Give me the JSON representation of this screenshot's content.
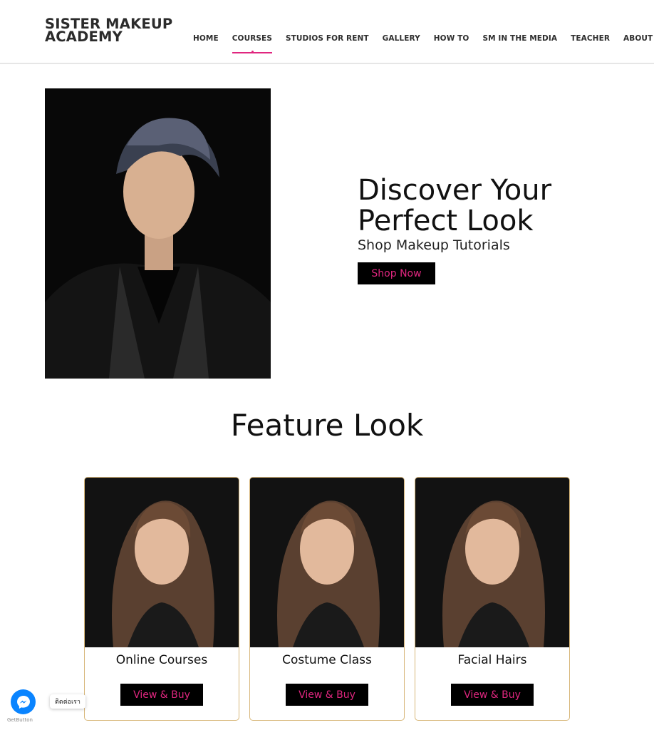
{
  "header": {
    "logo_line1": "SISTER MAKEUP",
    "logo_line2": "ACADEMY",
    "nav": [
      {
        "label": "HOME",
        "active": false
      },
      {
        "label": "COURSES",
        "active": true
      },
      {
        "label": "STUDIOS FOR RENT",
        "active": false
      },
      {
        "label": "GALLERY",
        "active": false
      },
      {
        "label": "HOW TO",
        "active": false
      },
      {
        "label": "SM IN THE MEDIA",
        "active": false
      },
      {
        "label": "TEACHER",
        "active": false
      },
      {
        "label": "ABOUT US",
        "active": false
      }
    ]
  },
  "hero": {
    "title_line1": "Discover Your",
    "title_line2": "Perfect Look",
    "subtitle": "Shop Makeup Tutorials",
    "button_label": "Shop Now"
  },
  "feature": {
    "title": "Feature Look",
    "cards": [
      {
        "label": "Online Courses",
        "button_label": "View & Buy"
      },
      {
        "label": "Costume Class",
        "button_label": "View & Buy"
      },
      {
        "label": "Facial Hairs",
        "button_label": "View & Buy"
      }
    ]
  },
  "widget": {
    "tooltip": "ติดต่อเรา",
    "brand": "GetButton"
  },
  "colors": {
    "accent": "#e0267f",
    "button_bg": "#000000",
    "card_border": "#d8b77a",
    "messenger": "#0a84ff"
  }
}
